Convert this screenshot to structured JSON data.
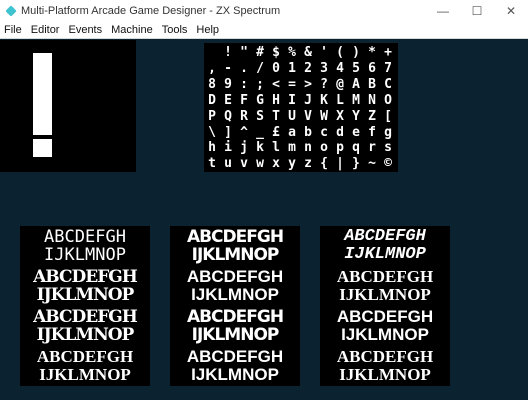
{
  "window": {
    "title": "Multi-Platform Arcade Game Designer - ZX Spectrum",
    "icon": "app-diamond-icon",
    "minimize": "—",
    "maximize": "☐",
    "close": "✕"
  },
  "menu": {
    "file": "File",
    "editor": "Editor",
    "events": "Events",
    "machine": "Machine",
    "tools": "Tools",
    "help": "Help"
  },
  "preview": {
    "character": "!"
  },
  "charset": {
    "rows": [
      [
        " ",
        "!",
        "\"",
        "#",
        "$",
        "%",
        "&",
        "'",
        "(",
        ")",
        "*",
        "+"
      ],
      [
        ",",
        "-",
        ".",
        "/",
        "0",
        "1",
        "2",
        "3",
        "4",
        "5",
        "6",
        "7"
      ],
      [
        "8",
        "9",
        ":",
        ";",
        "<",
        "=",
        ">",
        "?",
        "@",
        "A",
        "B",
        "C"
      ],
      [
        "D",
        "E",
        "F",
        "G",
        "H",
        "I",
        "J",
        "K",
        "L",
        "M",
        "N",
        "O"
      ],
      [
        "P",
        "Q",
        "R",
        "S",
        "T",
        "U",
        "V",
        "W",
        "X",
        "Y",
        "Z",
        "["
      ],
      [
        "\\",
        "]",
        "^",
        "_",
        "£",
        "a",
        "b",
        "c",
        "d",
        "e",
        "f",
        "g"
      ],
      [
        "h",
        "i",
        "j",
        "k",
        "l",
        "m",
        "n",
        "o",
        "p",
        "q",
        "r",
        "s"
      ],
      [
        "t",
        "u",
        "v",
        "w",
        "x",
        "y",
        "z",
        "{",
        "|",
        "}",
        "~",
        "©"
      ]
    ]
  },
  "fonts": [
    {
      "line1": "ABCDEFGH",
      "line2": "IJKLMNOP"
    },
    {
      "line1": "ABCDEFGH",
      "line2": "IJKLMNOP"
    },
    {
      "line1": "ABCDEFGH",
      "line2": "IJKLMNOP"
    },
    {
      "line1": "ABCDEFGH",
      "line2": "IJKLMNOP"
    },
    {
      "line1": "ABCDEFGH",
      "line2": "IJKLMNOP"
    },
    {
      "line1": "ABCDEFGH",
      "line2": "IJKLMNOP"
    },
    {
      "line1": "ABCDEFGH",
      "line2": "IJKLMNOP"
    },
    {
      "line1": "ABCDEFGH",
      "line2": "IJKLMNOP"
    },
    {
      "line1": "ABCDEFGH",
      "line2": "IJKLMNOP"
    },
    {
      "line1": "ABCDEFGH",
      "line2": "IJKLMNOP"
    },
    {
      "line1": "ABCDEFGH",
      "line2": "IJKLMNOP"
    },
    {
      "line1": "ABCDEFGH",
      "line2": "IJKLMNOP"
    }
  ],
  "colors": {
    "background": "#0b2230",
    "panel": "#000000",
    "pixel": "#ffffff",
    "app_icon": "#3fc3d0"
  }
}
